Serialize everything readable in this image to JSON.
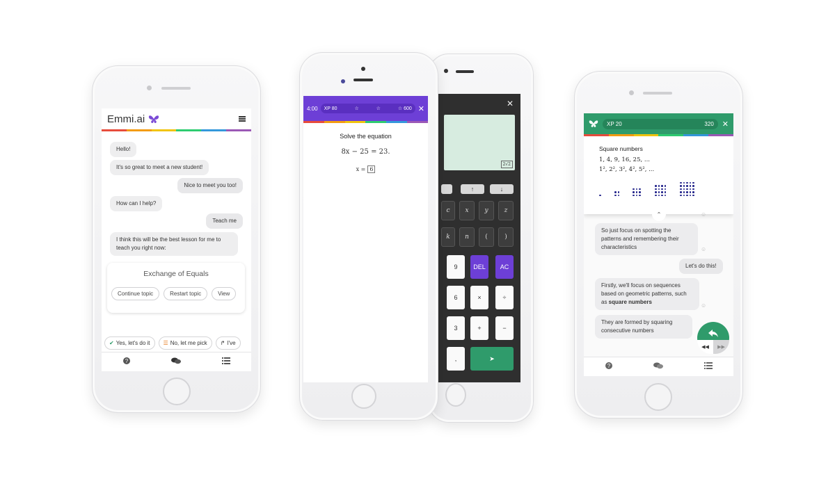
{
  "chat_app": {
    "brand": "Emmi.ai",
    "rainbow": [
      "#e74c3c",
      "#f39c12",
      "#f1c40f",
      "#2ecc71",
      "#3498db",
      "#9b59b6"
    ],
    "messages": [
      {
        "side": "left",
        "text": "Hello!"
      },
      {
        "side": "left",
        "text": "It's so great to meet a new student!"
      },
      {
        "side": "right",
        "text": "Nice to meet you too!"
      },
      {
        "side": "left",
        "text": "How can I help?"
      },
      {
        "side": "right",
        "text": "Teach me"
      },
      {
        "side": "left",
        "text": "I think this will be the best lesson for me to teach you right now:"
      }
    ],
    "topic_card": {
      "title": "Exchange of Equals",
      "buttons": [
        "Continue topic",
        "Restart topic",
        "View"
      ]
    },
    "quick_replies": [
      "Yes, let's do it",
      "No, let me pick",
      "I've"
    ]
  },
  "equation_app": {
    "timer": "4:00",
    "xp_label": "XP",
    "xp_value": "80",
    "xp_target": "600",
    "close": "✕",
    "title": "Solve the equation",
    "equation": "8x − 25 = 23.",
    "answer_prefix": "x =",
    "answer_value": "6"
  },
  "calculator": {
    "close": "✕",
    "display_result": "2√2",
    "keys": {
      "up": "↑",
      "down": "↓",
      "c": "c",
      "x": "x",
      "y": "y",
      "z": "z",
      "k": "k",
      "n": "n",
      "lparen": "(",
      "rparen": ")",
      "nine": "9",
      "del": "DEL",
      "ac": "AC",
      "six": "6",
      "times": "×",
      "frac": "÷",
      "three": "3",
      "plus": "+",
      "minus": "−",
      "comma": ",",
      "submit": "➤"
    }
  },
  "square_app": {
    "xp_label": "XP",
    "xp_value": "20",
    "xp_target": "320",
    "close": "✕",
    "card_title": "Square numbers",
    "seq_line1": "1, 4, 9, 16, 25, ...",
    "seq_line2": "1², 2², 3², 4², 5², ...",
    "messages": [
      {
        "side": "left",
        "text": "So just focus on spotting the patterns and remembering their characteristics"
      },
      {
        "side": "right",
        "text": "Let's do this!"
      },
      {
        "side": "left",
        "text_before": "Firstly, we'll focus on sequences based on geometric patterns, such as ",
        "text_bold": "square numbers"
      },
      {
        "side": "left",
        "text": "They are formed by squaring consecutive numbers"
      }
    ],
    "accent": "#2f9b6b"
  },
  "nav_icons": [
    "help-icon",
    "chat-icon",
    "list-icon"
  ]
}
